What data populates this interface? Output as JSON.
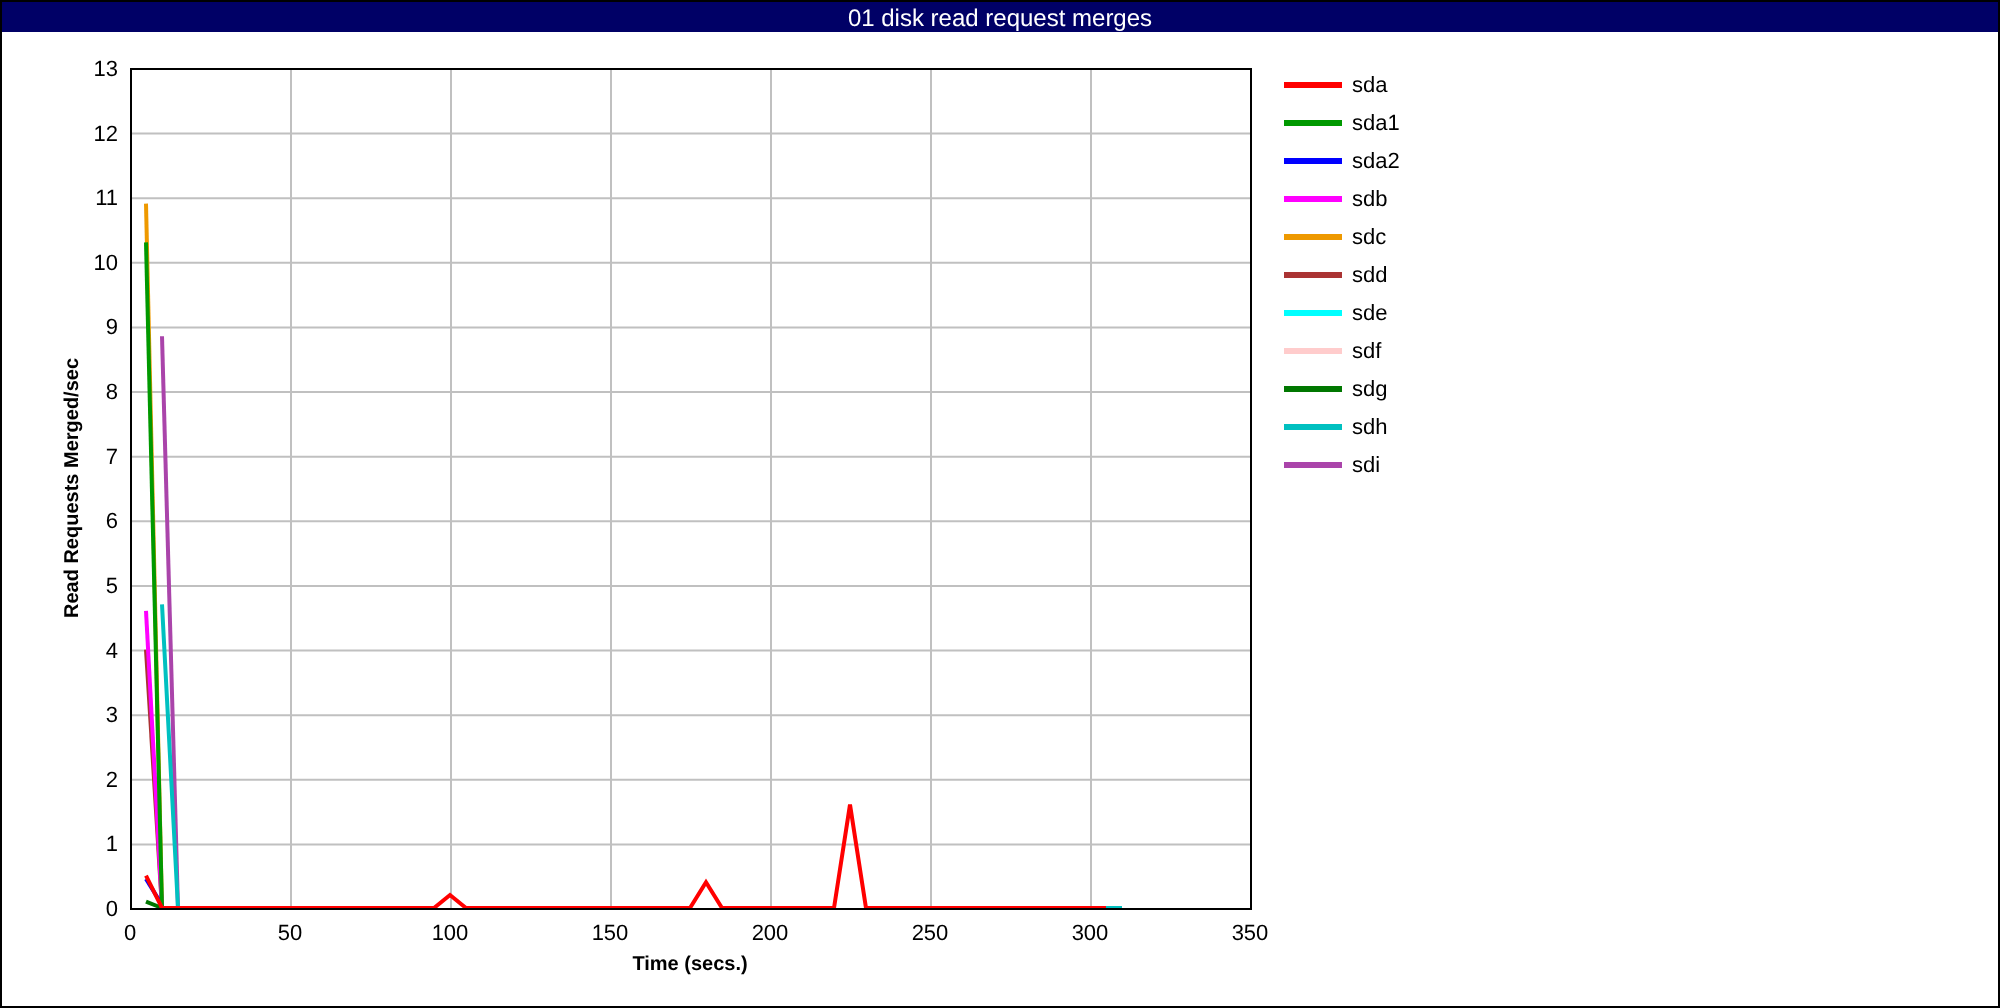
{
  "window": {
    "title": "01 disk read request merges"
  },
  "chart": {
    "chart_data": {
      "type": "line",
      "grid": true,
      "xlabel": "Time (secs.)",
      "ylabel": "Read Requests Merged/sec",
      "x": [
        5,
        10,
        15,
        20,
        25,
        30,
        35,
        40,
        45,
        50,
        55,
        60,
        65,
        70,
        75,
        80,
        85,
        90,
        95,
        100,
        105,
        110,
        115,
        120,
        125,
        130,
        135,
        140,
        145,
        150,
        155,
        160,
        165,
        170,
        175,
        180,
        185,
        190,
        195,
        200,
        205,
        210,
        215,
        220,
        225,
        230,
        235,
        240,
        245,
        250,
        255,
        260,
        265,
        270,
        275,
        280,
        285,
        290,
        295,
        300,
        305,
        310
      ],
      "xlim": [
        0,
        350
      ],
      "ylim": [
        0,
        13
      ],
      "xticks": [
        0,
        50,
        100,
        150,
        200,
        250,
        300,
        350
      ],
      "yticks": [
        0,
        1,
        2,
        3,
        4,
        5,
        6,
        7,
        8,
        9,
        10,
        11,
        12,
        13
      ],
      "series": [
        {
          "name": "sda",
          "color": "#ff0000",
          "values": [
            0.5,
            0,
            0,
            0,
            0,
            0,
            0,
            0,
            0,
            0,
            0,
            0,
            0,
            0,
            0,
            0,
            0,
            0,
            0,
            0.2,
            0,
            0,
            0,
            0,
            0,
            0,
            0,
            0,
            0,
            0,
            0,
            0,
            0,
            0,
            0,
            0.4,
            0,
            0,
            0,
            0,
            0,
            0,
            0,
            0,
            1.6,
            0,
            0,
            0,
            0,
            0,
            0,
            0,
            0,
            0,
            0,
            0,
            0,
            0,
            0,
            0,
            0,
            null
          ]
        },
        {
          "name": "sda1",
          "color": "#009900",
          "values": [
            10.3,
            0,
            null,
            null,
            null,
            null,
            null,
            null,
            null,
            null,
            null,
            null,
            null,
            null,
            null,
            null,
            null,
            null,
            null,
            null,
            null,
            null,
            null,
            null,
            null,
            null,
            null,
            null,
            null,
            null,
            null,
            null,
            null,
            null,
            null,
            null,
            null,
            null,
            null,
            null,
            null,
            null,
            null,
            null,
            null,
            null,
            null,
            null,
            null,
            null,
            null,
            null,
            null,
            null,
            null,
            null,
            null,
            null,
            null,
            null,
            null,
            null
          ]
        },
        {
          "name": "sda2",
          "color": "#0000ff",
          "values": [
            0.45,
            0.05,
            null,
            null,
            null,
            null,
            null,
            null,
            null,
            null,
            null,
            null,
            null,
            null,
            null,
            null,
            null,
            null,
            null,
            null,
            null,
            null,
            null,
            null,
            null,
            null,
            null,
            null,
            null,
            null,
            null,
            null,
            null,
            null,
            null,
            null,
            null,
            null,
            null,
            null,
            null,
            null,
            null,
            null,
            null,
            null,
            null,
            null,
            null,
            null,
            null,
            null,
            null,
            null,
            null,
            null,
            null,
            null,
            null,
            null,
            null,
            null
          ]
        },
        {
          "name": "sdb",
          "color": "#ff00ff",
          "values": [
            4.6,
            0,
            null,
            null,
            null,
            null,
            null,
            null,
            null,
            null,
            null,
            null,
            null,
            null,
            null,
            null,
            null,
            null,
            null,
            null,
            null,
            null,
            null,
            null,
            null,
            null,
            null,
            null,
            null,
            null,
            null,
            null,
            null,
            null,
            null,
            null,
            null,
            null,
            null,
            null,
            null,
            null,
            null,
            null,
            null,
            null,
            null,
            null,
            null,
            null,
            null,
            null,
            null,
            null,
            null,
            null,
            null,
            null,
            null,
            null,
            null,
            null
          ]
        },
        {
          "name": "sdc",
          "color": "#ee9900",
          "values": [
            10.9,
            0,
            null,
            null,
            null,
            null,
            null,
            null,
            null,
            null,
            null,
            null,
            null,
            null,
            null,
            null,
            null,
            null,
            null,
            null,
            null,
            null,
            null,
            null,
            null,
            null,
            null,
            null,
            null,
            null,
            null,
            null,
            null,
            null,
            null,
            null,
            null,
            null,
            null,
            null,
            null,
            null,
            null,
            null,
            null,
            null,
            null,
            null,
            null,
            null,
            null,
            null,
            null,
            null,
            null,
            null,
            null,
            null,
            null,
            null,
            null,
            null
          ]
        },
        {
          "name": "sdd",
          "color": "#aa3333",
          "values": [
            4.0,
            0,
            null,
            null,
            null,
            null,
            null,
            null,
            null,
            null,
            null,
            null,
            null,
            null,
            null,
            null,
            null,
            null,
            null,
            null,
            null,
            null,
            null,
            null,
            null,
            null,
            null,
            null,
            null,
            null,
            null,
            null,
            null,
            null,
            null,
            null,
            null,
            null,
            null,
            null,
            null,
            null,
            null,
            null,
            null,
            null,
            null,
            null,
            null,
            null,
            null,
            null,
            null,
            null,
            null,
            null,
            null,
            null,
            null,
            null,
            null,
            null
          ]
        },
        {
          "name": "sde",
          "color": "#00ffff",
          "values": [
            null,
            null,
            null,
            null,
            null,
            null,
            null,
            null,
            null,
            null,
            null,
            null,
            null,
            null,
            null,
            null,
            null,
            null,
            null,
            null,
            null,
            null,
            null,
            null,
            null,
            null,
            null,
            null,
            null,
            null,
            null,
            null,
            null,
            null,
            null,
            null,
            null,
            null,
            null,
            null,
            null,
            null,
            null,
            null,
            null,
            null,
            null,
            null,
            null,
            null,
            null,
            null,
            null,
            null,
            null,
            null,
            null,
            null,
            null,
            null,
            null,
            null
          ]
        },
        {
          "name": "sdf",
          "color": "#ffcccc",
          "values": [
            null,
            null,
            null,
            null,
            null,
            null,
            null,
            null,
            null,
            null,
            null,
            null,
            null,
            null,
            null,
            null,
            null,
            null,
            null,
            null,
            null,
            null,
            null,
            null,
            null,
            null,
            null,
            null,
            null,
            null,
            null,
            null,
            null,
            null,
            null,
            null,
            null,
            null,
            null,
            null,
            null,
            null,
            null,
            null,
            null,
            null,
            null,
            null,
            null,
            null,
            null,
            null,
            null,
            null,
            null,
            null,
            null,
            null,
            null,
            null,
            null,
            null
          ]
        },
        {
          "name": "sdg",
          "color": "#007700",
          "values": [
            0.1,
            0,
            null,
            null,
            null,
            null,
            null,
            null,
            null,
            null,
            null,
            null,
            null,
            null,
            null,
            null,
            null,
            null,
            null,
            null,
            null,
            null,
            null,
            null,
            null,
            null,
            null,
            null,
            null,
            null,
            null,
            null,
            null,
            null,
            null,
            null,
            null,
            null,
            null,
            null,
            null,
            null,
            null,
            null,
            null,
            null,
            null,
            null,
            null,
            null,
            null,
            null,
            null,
            null,
            null,
            null,
            null,
            null,
            null,
            null,
            null,
            null
          ]
        },
        {
          "name": "sdh",
          "color": "#00c0c0",
          "values": [
            null,
            4.7,
            0,
            null,
            null,
            null,
            null,
            null,
            null,
            null,
            null,
            null,
            null,
            null,
            null,
            null,
            null,
            null,
            null,
            null,
            null,
            null,
            null,
            null,
            null,
            null,
            null,
            null,
            null,
            null,
            null,
            null,
            null,
            null,
            null,
            null,
            null,
            null,
            null,
            null,
            null,
            null,
            null,
            null,
            null,
            null,
            null,
            null,
            null,
            null,
            null,
            null,
            null,
            null,
            null,
            null,
            null,
            null,
            null,
            null,
            0,
            0
          ]
        },
        {
          "name": "sdi",
          "color": "#aa44aa",
          "values": [
            null,
            8.85,
            0,
            null,
            null,
            null,
            null,
            null,
            null,
            null,
            null,
            null,
            null,
            null,
            null,
            null,
            null,
            null,
            null,
            null,
            null,
            null,
            null,
            null,
            null,
            null,
            null,
            null,
            null,
            null,
            null,
            null,
            null,
            null,
            null,
            null,
            null,
            null,
            null,
            null,
            null,
            null,
            null,
            null,
            null,
            null,
            null,
            null,
            null,
            null,
            null,
            null,
            null,
            null,
            null,
            null,
            null,
            null,
            null,
            null,
            null,
            null
          ]
        }
      ]
    }
  }
}
